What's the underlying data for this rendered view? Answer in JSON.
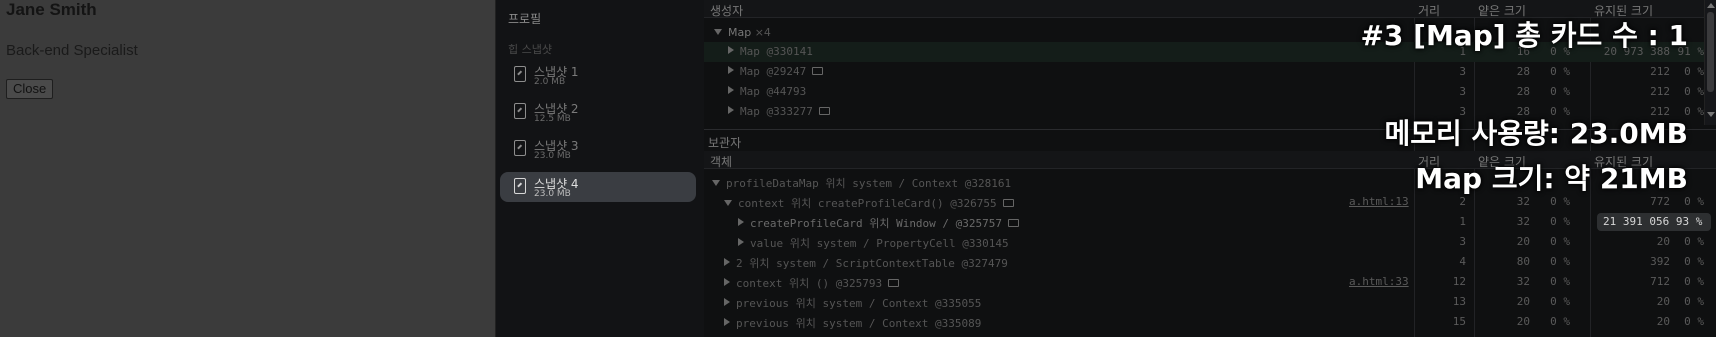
{
  "page": {
    "name": "Jane Smith",
    "role": "Back-end Specialist",
    "close_label": "Close"
  },
  "sidebar": {
    "title": "프로필",
    "section": "힙 스냅샷",
    "snapshots": [
      {
        "name": "스냅샷 1",
        "size": "2.0 MB",
        "selected": false
      },
      {
        "name": "스냅샷 2",
        "size": "12.5 MB",
        "selected": false
      },
      {
        "name": "스냅샷 3",
        "size": "23.0 MB",
        "selected": false
      },
      {
        "name": "스냅샷 4",
        "size": "23.0 MB",
        "selected": true
      }
    ]
  },
  "constructors": {
    "header": "생성자",
    "columns": {
      "distance": "거리",
      "shallow": "얕은 크기",
      "retained": "유지된 크기"
    },
    "group": {
      "label": "Map",
      "count": "×4"
    },
    "rows": [
      {
        "label": "Map @330141",
        "distance": "",
        "shallow": "",
        "shallow_pct": "",
        "retained": "",
        "retained_pct": ""
      },
      {
        "label": "",
        "distance": "1",
        "shallow": "16",
        "shallow_pct": "0 %",
        "retained": "20 973 388",
        "retained_pct": "91 %"
      },
      {
        "label": "Map @29247",
        "distance": "3",
        "shallow": "28",
        "shallow_pct": "0 %",
        "retained": "212",
        "retained_pct": "0 %"
      },
      {
        "label": "Map @44793",
        "distance": "3",
        "shallow": "28",
        "shallow_pct": "0 %",
        "retained": "212",
        "retained_pct": "0 %"
      },
      {
        "label": "Map @333277",
        "distance": "3",
        "shallow": "28",
        "shallow_pct": "0 %",
        "retained": "212",
        "retained_pct": "0 %"
      }
    ]
  },
  "retainers": {
    "header": "보관자",
    "subheader": "객체",
    "columns": {
      "distance": "거리",
      "shallow": "얕은 크기",
      "retained": "유지된 크기"
    },
    "rows": [
      {
        "label": "profileDataMap 위치 system / Context @328161",
        "link": "",
        "distance": "",
        "shallow": "",
        "shallow_pct": "",
        "retained": "",
        "retained_pct": ""
      },
      {
        "label": "context 위치 createProfileCard() @326755",
        "link": "a.html:13",
        "distance": "2",
        "shallow": "32",
        "shallow_pct": "0 %",
        "retained": "772",
        "retained_pct": "0 %"
      },
      {
        "label": "createProfileCard 위치 Window / @325757",
        "link": "",
        "distance": "1",
        "shallow": "32",
        "shallow_pct": "0 %",
        "retained": "21 391 056",
        "retained_pct": "93 %"
      },
      {
        "label": "value 위치 system / PropertyCell @330145",
        "link": "",
        "distance": "3",
        "shallow": "20",
        "shallow_pct": "0 %",
        "retained": "20",
        "retained_pct": "0 %"
      },
      {
        "label": "2 위치 system / ScriptContextTable @327479",
        "link": "",
        "distance": "4",
        "shallow": "80",
        "shallow_pct": "0 %",
        "retained": "392",
        "retained_pct": "0 %"
      },
      {
        "label": "context 위치 () @325793",
        "link": "a.html:33",
        "distance": "12",
        "shallow": "32",
        "shallow_pct": "0 %",
        "retained": "712",
        "retained_pct": "0 %"
      },
      {
        "label": "previous 위치 system / Context @335055",
        "link": "",
        "distance": "13",
        "shallow": "20",
        "shallow_pct": "0 %",
        "retained": "20",
        "retained_pct": "0 %"
      },
      {
        "label": "previous 위치 system / Context @335089",
        "link": "",
        "distance": "15",
        "shallow": "20",
        "shallow_pct": "0 %",
        "retained": "20",
        "retained_pct": "0 %"
      }
    ]
  },
  "overlay": {
    "line1": "#3 [Map] 총 카드 수 : 1",
    "line2": "메모리 사용량: 23.0MB",
    "line3": "Map 크기: 약 21MB"
  },
  "colors": {
    "overlay_text": "#ffffff",
    "selected_snapshot_bg": "#3a3d42",
    "highlight_row_bg": "#141d19"
  }
}
